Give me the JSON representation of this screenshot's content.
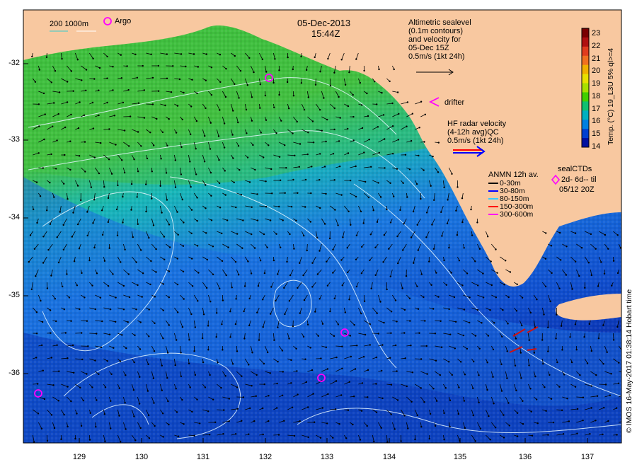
{
  "header": {
    "date": "05-Dec-2013",
    "time": "15:44Z",
    "scale_label": "200  1000m",
    "argo_label": "Argo"
  },
  "altimetry_note": {
    "lines": [
      "Altimetric sealevel",
      "(0.1m contours)",
      "and velocity for",
      "05-Dec 15Z",
      "0.5m/s (1kt 24h)"
    ]
  },
  "drifter_label": "drifter",
  "hf_radar": {
    "lines": [
      "HF radar velocity",
      "(4-12h avg)QC",
      "0.5m/s (1kt 24h)"
    ]
  },
  "anmn": {
    "title": "ANMN 12h av.",
    "items": [
      {
        "label": "0-30m",
        "color": "#000000"
      },
      {
        "label": "30-80m",
        "color": "#0000ff"
      },
      {
        "label": "80-150m",
        "color": "#33ccff"
      },
      {
        "label": "150-300m",
        "color": "#ff0000"
      },
      {
        "label": "300-600m",
        "color": "#ff00ff"
      }
    ]
  },
  "seal_ctds": {
    "lines": [
      "sealCTDs",
      "2d- 6d-- til",
      "05/12 20Z"
    ]
  },
  "colorbar": {
    "title": "Temp. (°C) 19_L3U 5% ql>=4",
    "ticks": [
      "23",
      "22",
      "21",
      "20",
      "19",
      "18",
      "17",
      "16",
      "15",
      "14"
    ],
    "colors": [
      "#7a0000",
      "#b01010",
      "#e03c1e",
      "#f07020",
      "#f0b000",
      "#e8e000",
      "#a8e000",
      "#40d000",
      "#10c070",
      "#00b0c0",
      "#0080e0",
      "#0040d0",
      "#0010a0"
    ]
  },
  "credit": "© IMOS 16-May-2017 01:38:14 Hobart time",
  "axes": {
    "x_ticks": [
      "129",
      "130",
      "131",
      "132",
      "133",
      "134",
      "135",
      "136",
      "137"
    ],
    "y_ticks": [
      "-32",
      "-33",
      "-34",
      "-35",
      "-36"
    ]
  },
  "map_colors": {
    "land": "#f8c8a0",
    "green_sst": "#3fc040",
    "cyan_sst": "#12b8c8",
    "blue_sst": "#1c70e0",
    "deep_blue_sst": "#0a30b8"
  }
}
